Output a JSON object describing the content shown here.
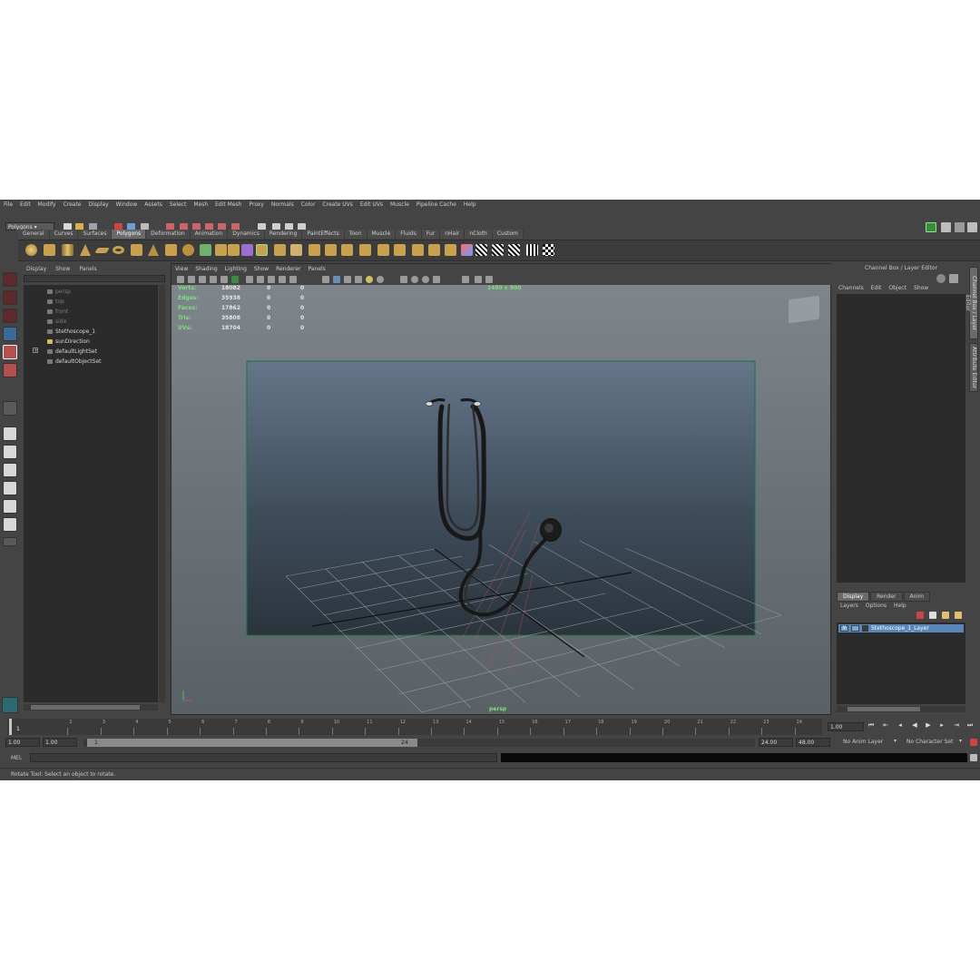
{
  "menubar": [
    "File",
    "Edit",
    "Modify",
    "Create",
    "Display",
    "Window",
    "Assets",
    "Select",
    "Mesh",
    "Edit Mesh",
    "Proxy",
    "Normals",
    "Color",
    "Create UVs",
    "Edit UVs",
    "Muscle",
    "Pipeline Cache",
    "Help"
  ],
  "status_line": {
    "mode": "Polygons"
  },
  "shelf_tabs": [
    "General",
    "Curves",
    "Surfaces",
    "Polygons",
    "Deformation",
    "Animation",
    "Dynamics",
    "Rendering",
    "PaintEffects",
    "Toon",
    "Muscle",
    "Fluids",
    "Fur",
    "nHair",
    "nCloth",
    "Custom"
  ],
  "shelf_active": "Polygons",
  "outliner": {
    "menu": [
      "Display",
      "Show",
      "Panels"
    ],
    "items": [
      {
        "label": "persp",
        "dim": true
      },
      {
        "label": "top",
        "dim": true
      },
      {
        "label": "front",
        "dim": true
      },
      {
        "label": "side",
        "dim": true
      },
      {
        "label": "Stethoscope_1",
        "dim": false
      },
      {
        "label": "sunDirection",
        "dim": false
      },
      {
        "label": "defaultLightSet",
        "dim": false
      },
      {
        "label": "defaultObjectSet",
        "dim": false
      }
    ]
  },
  "viewport": {
    "menu": [
      "View",
      "Shading",
      "Lighting",
      "Show",
      "Renderer",
      "Panels"
    ],
    "resolution": "1480 x 900",
    "camera": "persp",
    "hud": [
      {
        "label": "Verts:",
        "values": [
          "18082",
          "0",
          "0"
        ]
      },
      {
        "label": "Edges:",
        "values": [
          "35938",
          "0",
          "0"
        ]
      },
      {
        "label": "Faces:",
        "values": [
          "17862",
          "0",
          "0"
        ]
      },
      {
        "label": "Tris:",
        "values": [
          "35808",
          "0",
          "0"
        ]
      },
      {
        "label": "UVs:",
        "values": [
          "18704",
          "0",
          "0"
        ]
      }
    ]
  },
  "channel_box": {
    "title": "Channel Box / Layer Editor",
    "menu": [
      "Channels",
      "Edit",
      "Object",
      "Show"
    ],
    "side_tabs": [
      "Channel Box / Layer Editor",
      "Attribute Editor"
    ]
  },
  "layer_editor": {
    "tabs": [
      "Display",
      "Render",
      "Anim"
    ],
    "active_tab": "Display",
    "menu": [
      "Layers",
      "Options",
      "Help"
    ],
    "layers": [
      "Stethoscope_1_Layer"
    ]
  },
  "time_slider": {
    "ticks": [
      "1",
      "2",
      "3",
      "4",
      "5",
      "6",
      "7",
      "8",
      "9",
      "10",
      "11",
      "12",
      "13",
      "14",
      "15",
      "16",
      "17",
      "18",
      "19",
      "20",
      "21",
      "22",
      "23",
      "24"
    ],
    "current_frame": "1",
    "current_time_field": "1.00"
  },
  "range_slider": {
    "start_field": "1.00",
    "anim_start_field": "1.00",
    "range_start": "1",
    "range_end": "24",
    "end_field": "24.00",
    "anim_end_field": "48.00",
    "anim_layer": "No Anim Layer",
    "character_set": "No Character Set"
  },
  "command_line": {
    "label": "MEL"
  },
  "help_line": "Rotate Tool: Select an object to rotate.",
  "colors": {
    "hud_green": "#7ce27c",
    "selection_blue": "#5a87b7",
    "panel_bg": "#444444"
  }
}
